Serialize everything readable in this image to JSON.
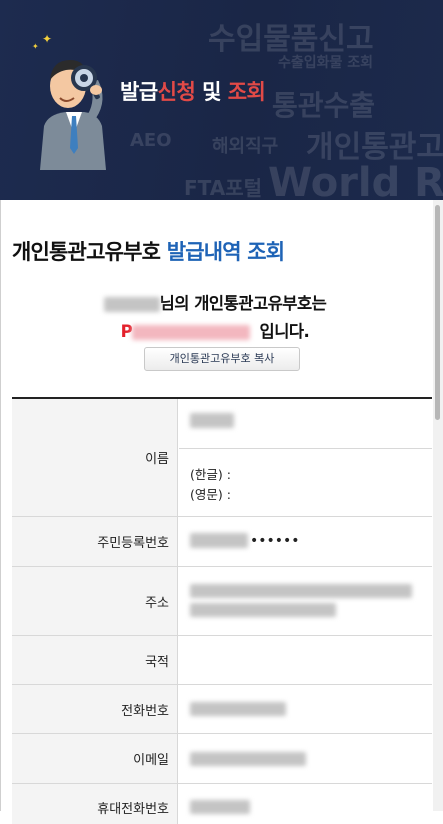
{
  "banner": {
    "title_part1": "발급",
    "title_accent1": "신청",
    "title_part2": " 및 ",
    "title_accent2": "조회",
    "background_words": [
      "수입물품신고",
      "수출입화물 조회",
      "통관수출",
      "개인통관고유",
      "AEO",
      "해외직구",
      "FTA포털",
      "World Re"
    ]
  },
  "heading": {
    "title_main": "개인통관고유부호",
    "title_accent": "발급내역 조회"
  },
  "message": {
    "line1_suffix": "님의 개인통관고유부호는",
    "code_prefix": "P",
    "line2_suffix": "입니다."
  },
  "copy_button": {
    "label": "개인통관고유부호 복사"
  },
  "table": {
    "name": {
      "label": "이름",
      "korean_label": "(한글) :",
      "english_label": "(영문) :"
    },
    "rrn": {
      "label": "주민등록번호",
      "masked": "••••••"
    },
    "address": {
      "label": "주소"
    },
    "nationality": {
      "label": "국적"
    },
    "phone": {
      "label": "전화번호"
    },
    "email": {
      "label": "이메일"
    },
    "mobile": {
      "label": "휴대전화번호"
    }
  },
  "colors": {
    "banner_bg": "#1d2b4f",
    "accent_red": "#e24a47",
    "heading_blue": "#1e63b6",
    "code_red": "#e3202b"
  }
}
